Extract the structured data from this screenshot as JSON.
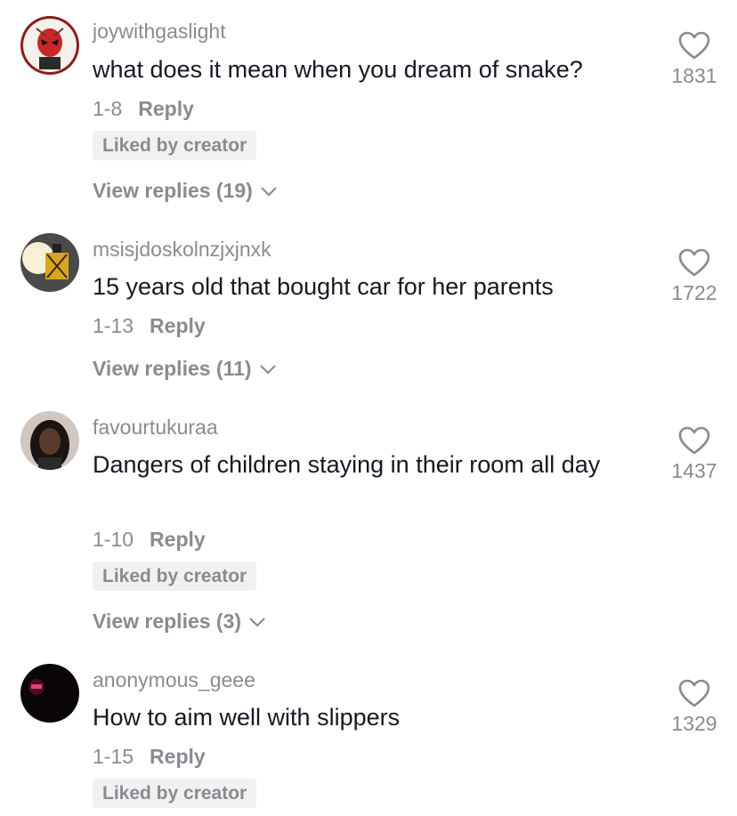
{
  "comments": [
    {
      "username": "joywithgaslight",
      "text": "what does it mean when you dream of snake?",
      "date": "1-8",
      "reply_label": "Reply",
      "liked_by_creator": "Liked by creator",
      "view_replies": "View replies (19)",
      "likes": "1831",
      "avatar": "deadpool-avatar"
    },
    {
      "username": "msisjdoskolnzjxjnxk",
      "text": "15 years old that bought car for her parents",
      "date": "1-13",
      "reply_label": "Reply",
      "view_replies": "View replies (11)",
      "likes": "1722",
      "avatar": "lantern-avatar"
    },
    {
      "username": "favourtukuraa",
      "text": "Dangers of children staying in their room all day",
      "date": "1-10",
      "reply_label": "Reply",
      "liked_by_creator": "Liked by creator",
      "view_replies": "View replies (3)",
      "likes": "1437",
      "avatar": "portrait-avatar"
    },
    {
      "username": "anonymous_geee",
      "text": "How to aim well with slippers",
      "date": "1-15",
      "reply_label": "Reply",
      "liked_by_creator": "Liked by creator",
      "likes": "1329",
      "avatar": "dark-neon-avatar"
    }
  ],
  "colors": {
    "text": "#161823",
    "secondary": "#8a8b91",
    "badge_bg": "#f1f1f2"
  },
  "icons": {
    "like": "heart-outline-icon",
    "expand": "chevron-down-icon"
  }
}
